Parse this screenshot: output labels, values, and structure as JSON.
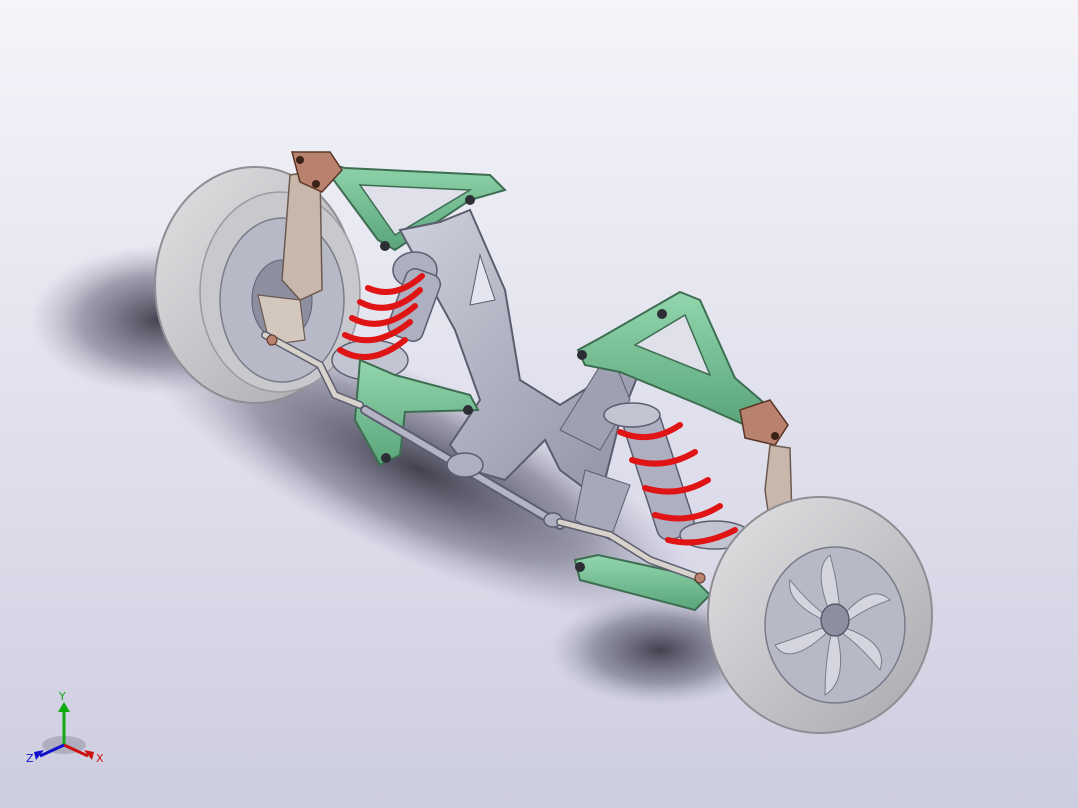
{
  "viewport": {
    "background_top": "#f4f4fa",
    "background_bottom": "#cdcde0"
  },
  "model": {
    "colors": {
      "tire": "#d3d3d6",
      "tire_edge": "#9a9aa0",
      "rim": "#b8b9c6",
      "hub": "#8d8ea0",
      "control_arm": "#7dc59c",
      "control_arm_edge": "#3d6e52",
      "spring": "#e01414",
      "spring_dark": "#8a0c0c",
      "frame": "#b4b5c4",
      "frame_edge": "#5c5d6e",
      "bracket": "#b9826e",
      "upright": "#c8b8ac",
      "damper": "#aeb0c2"
    }
  },
  "triad": {
    "x_label": "X",
    "y_label": "Y",
    "z_label": "Z",
    "x_color": "#cc1111",
    "y_color": "#11aa11",
    "z_color": "#1111cc"
  }
}
